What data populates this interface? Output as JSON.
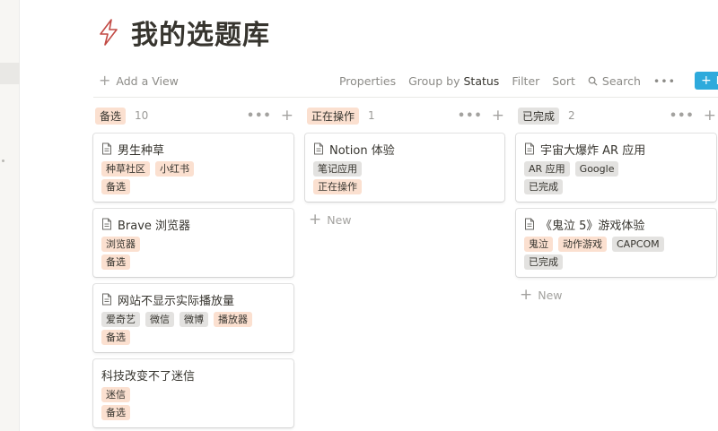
{
  "page": {
    "title": "我的选题库"
  },
  "toolbar": {
    "add_view": "Add a View",
    "properties": "Properties",
    "group_by_prefix": "Group by",
    "group_by_value": "Status",
    "filter": "Filter",
    "sort": "Sort",
    "search": "Search",
    "more": "•••",
    "new_label": "N"
  },
  "board": {
    "columns": [
      {
        "label": "备选",
        "count": "10",
        "tag_color": "orange",
        "cards": [
          {
            "title": "男生种草",
            "has_doc_icon": true,
            "tags": [
              {
                "text": "种草社区",
                "color": "orange"
              },
              {
                "text": "小红书",
                "color": "orange"
              }
            ],
            "status": "备选"
          },
          {
            "title": "Brave 浏览器",
            "has_doc_icon": true,
            "tags": [
              {
                "text": "浏览器",
                "color": "orange"
              }
            ],
            "status": "备选"
          },
          {
            "title": "网站不显示实际播放量",
            "has_doc_icon": true,
            "tags": [
              {
                "text": "爱奇艺",
                "color": "gray"
              },
              {
                "text": "微信",
                "color": "gray"
              },
              {
                "text": "微博",
                "color": "gray"
              },
              {
                "text": "播放器",
                "color": "orange"
              }
            ],
            "status": "备选"
          },
          {
            "title": "科技改变不了迷信",
            "has_doc_icon": false,
            "tags": [
              {
                "text": "迷信",
                "color": "orange"
              }
            ],
            "status": "备选"
          }
        ]
      },
      {
        "label": "正在操作",
        "count": "1",
        "tag_color": "orange",
        "new_label": "New",
        "cards": [
          {
            "title": "Notion 体验",
            "has_doc_icon": true,
            "tags": [
              {
                "text": "笔记应用",
                "color": "gray"
              }
            ],
            "status": "正在操作"
          }
        ]
      },
      {
        "label": "已完成",
        "count": "2",
        "tag_color": "gray",
        "new_label": "New",
        "cards": [
          {
            "title": "宇宙大爆炸 AR 应用",
            "has_doc_icon": true,
            "tags": [
              {
                "text": "AR 应用",
                "color": "gray"
              },
              {
                "text": "Google",
                "color": "gray"
              }
            ],
            "status": "已完成"
          },
          {
            "title": "《鬼泣 5》游戏体验",
            "has_doc_icon": true,
            "tags": [
              {
                "text": "鬼泣",
                "color": "orange"
              },
              {
                "text": "动作游戏",
                "color": "orange"
              },
              {
                "text": "CAPCOM",
                "color": "gray"
              }
            ],
            "status": "已完成"
          }
        ]
      }
    ]
  },
  "colors": {
    "orange_tag": "#fbe0d0",
    "gray_tag": "#e3e2e0",
    "accent_blue": "#2eaadc",
    "title_icon": "#c24a45"
  },
  "icons": {
    "title": "lightning-icon",
    "card": "document-icon",
    "search": "search-icon",
    "add": "plus-icon",
    "more": "more-dots-icon"
  }
}
